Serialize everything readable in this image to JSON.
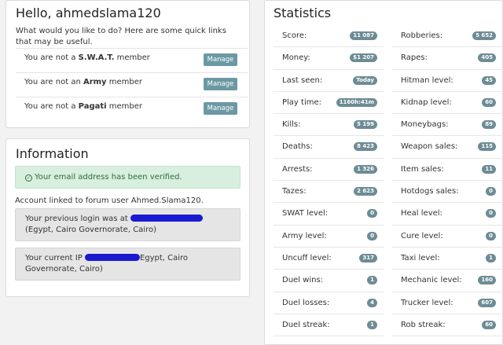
{
  "hello": {
    "title": "Hello, ahmedslama120",
    "intro": "What would you like to do? Here are some quick links that may be useful.",
    "memberships": [
      {
        "prefix": "You are not a ",
        "group": "S.W.A.T.",
        "suffix": " member",
        "button": "Manage"
      },
      {
        "prefix": "You are not an ",
        "group": "Army",
        "suffix": " member",
        "button": "Manage"
      },
      {
        "prefix": "You are not a ",
        "group": "Pagati",
        "suffix": " member",
        "button": "Manage"
      }
    ]
  },
  "info": {
    "title": "Information",
    "verified": "Your email address has been verified.",
    "linked": "Account linked to forum user Ahmed.Slama120.",
    "previous_prefix": "Your previous login was at ",
    "previous_suffix": "(Egypt, Cairo Governorate, Cairo)",
    "current_prefix": "Your current IP ",
    "current_suffix": "Egypt, Cairo Governorate, Cairo)"
  },
  "stats": {
    "title": "Statistics",
    "left": [
      {
        "label": "Score:",
        "value": "11 087"
      },
      {
        "label": "Money:",
        "value": "$1 207"
      },
      {
        "label": "Last seen:",
        "value": "Today"
      },
      {
        "label": "Play time:",
        "value": "1160h:41m"
      },
      {
        "label": "Kills:",
        "value": "5 199"
      },
      {
        "label": "Deaths:",
        "value": "8 423"
      },
      {
        "label": "Arrests:",
        "value": "1 326"
      },
      {
        "label": "Tazes:",
        "value": "2 623"
      },
      {
        "label": "SWAT level:",
        "value": "0"
      },
      {
        "label": "Army level:",
        "value": "0"
      },
      {
        "label": "Uncuff level:",
        "value": "317"
      },
      {
        "label": "Duel wins:",
        "value": "1"
      },
      {
        "label": "Duel losses:",
        "value": "4"
      },
      {
        "label": "Duel streak:",
        "value": "1"
      }
    ],
    "right": [
      {
        "label": "Robberies:",
        "value": "5 652"
      },
      {
        "label": "Rapes:",
        "value": "405"
      },
      {
        "label": "Hitman level:",
        "value": "45"
      },
      {
        "label": "Kidnap level:",
        "value": "60"
      },
      {
        "label": "Moneybags:",
        "value": "89"
      },
      {
        "label": "Weapon sales:",
        "value": "115"
      },
      {
        "label": "Item sales:",
        "value": "11"
      },
      {
        "label": "Hotdogs sales:",
        "value": "0"
      },
      {
        "label": "Heal level:",
        "value": "0"
      },
      {
        "label": "Cure level:",
        "value": "0"
      },
      {
        "label": "Taxi level:",
        "value": "1"
      },
      {
        "label": "Mechanic level:",
        "value": "160"
      },
      {
        "label": "Trucker level:",
        "value": "607"
      },
      {
        "label": "Rob streak:",
        "value": "60"
      }
    ]
  }
}
